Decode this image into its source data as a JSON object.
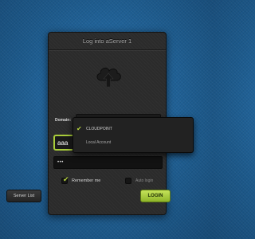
{
  "dialog": {
    "title": "Log into aServer 1"
  },
  "domain": {
    "label": "Domain:",
    "options": [
      "CLOUDPOINT",
      "Local Account"
    ],
    "selected": "CLOUDPOINT"
  },
  "username": {
    "value": "aaa"
  },
  "password": {
    "masked_value": "•••"
  },
  "options": {
    "remember_me_label": "Remember me",
    "remember_me_checked": true,
    "auto_login_label": "Auto login",
    "auto_login_checked": false
  },
  "buttons": {
    "server_list_label": "Server List",
    "login_label": "LOGIN"
  },
  "colors": {
    "accent": "#a9cc3a",
    "background": "#1f5f92",
    "panel": "#2b2b2b"
  },
  "icons": {
    "logo": "cloud-upload-icon",
    "check": "check-icon",
    "dropdown": "chevron-down-icon"
  }
}
